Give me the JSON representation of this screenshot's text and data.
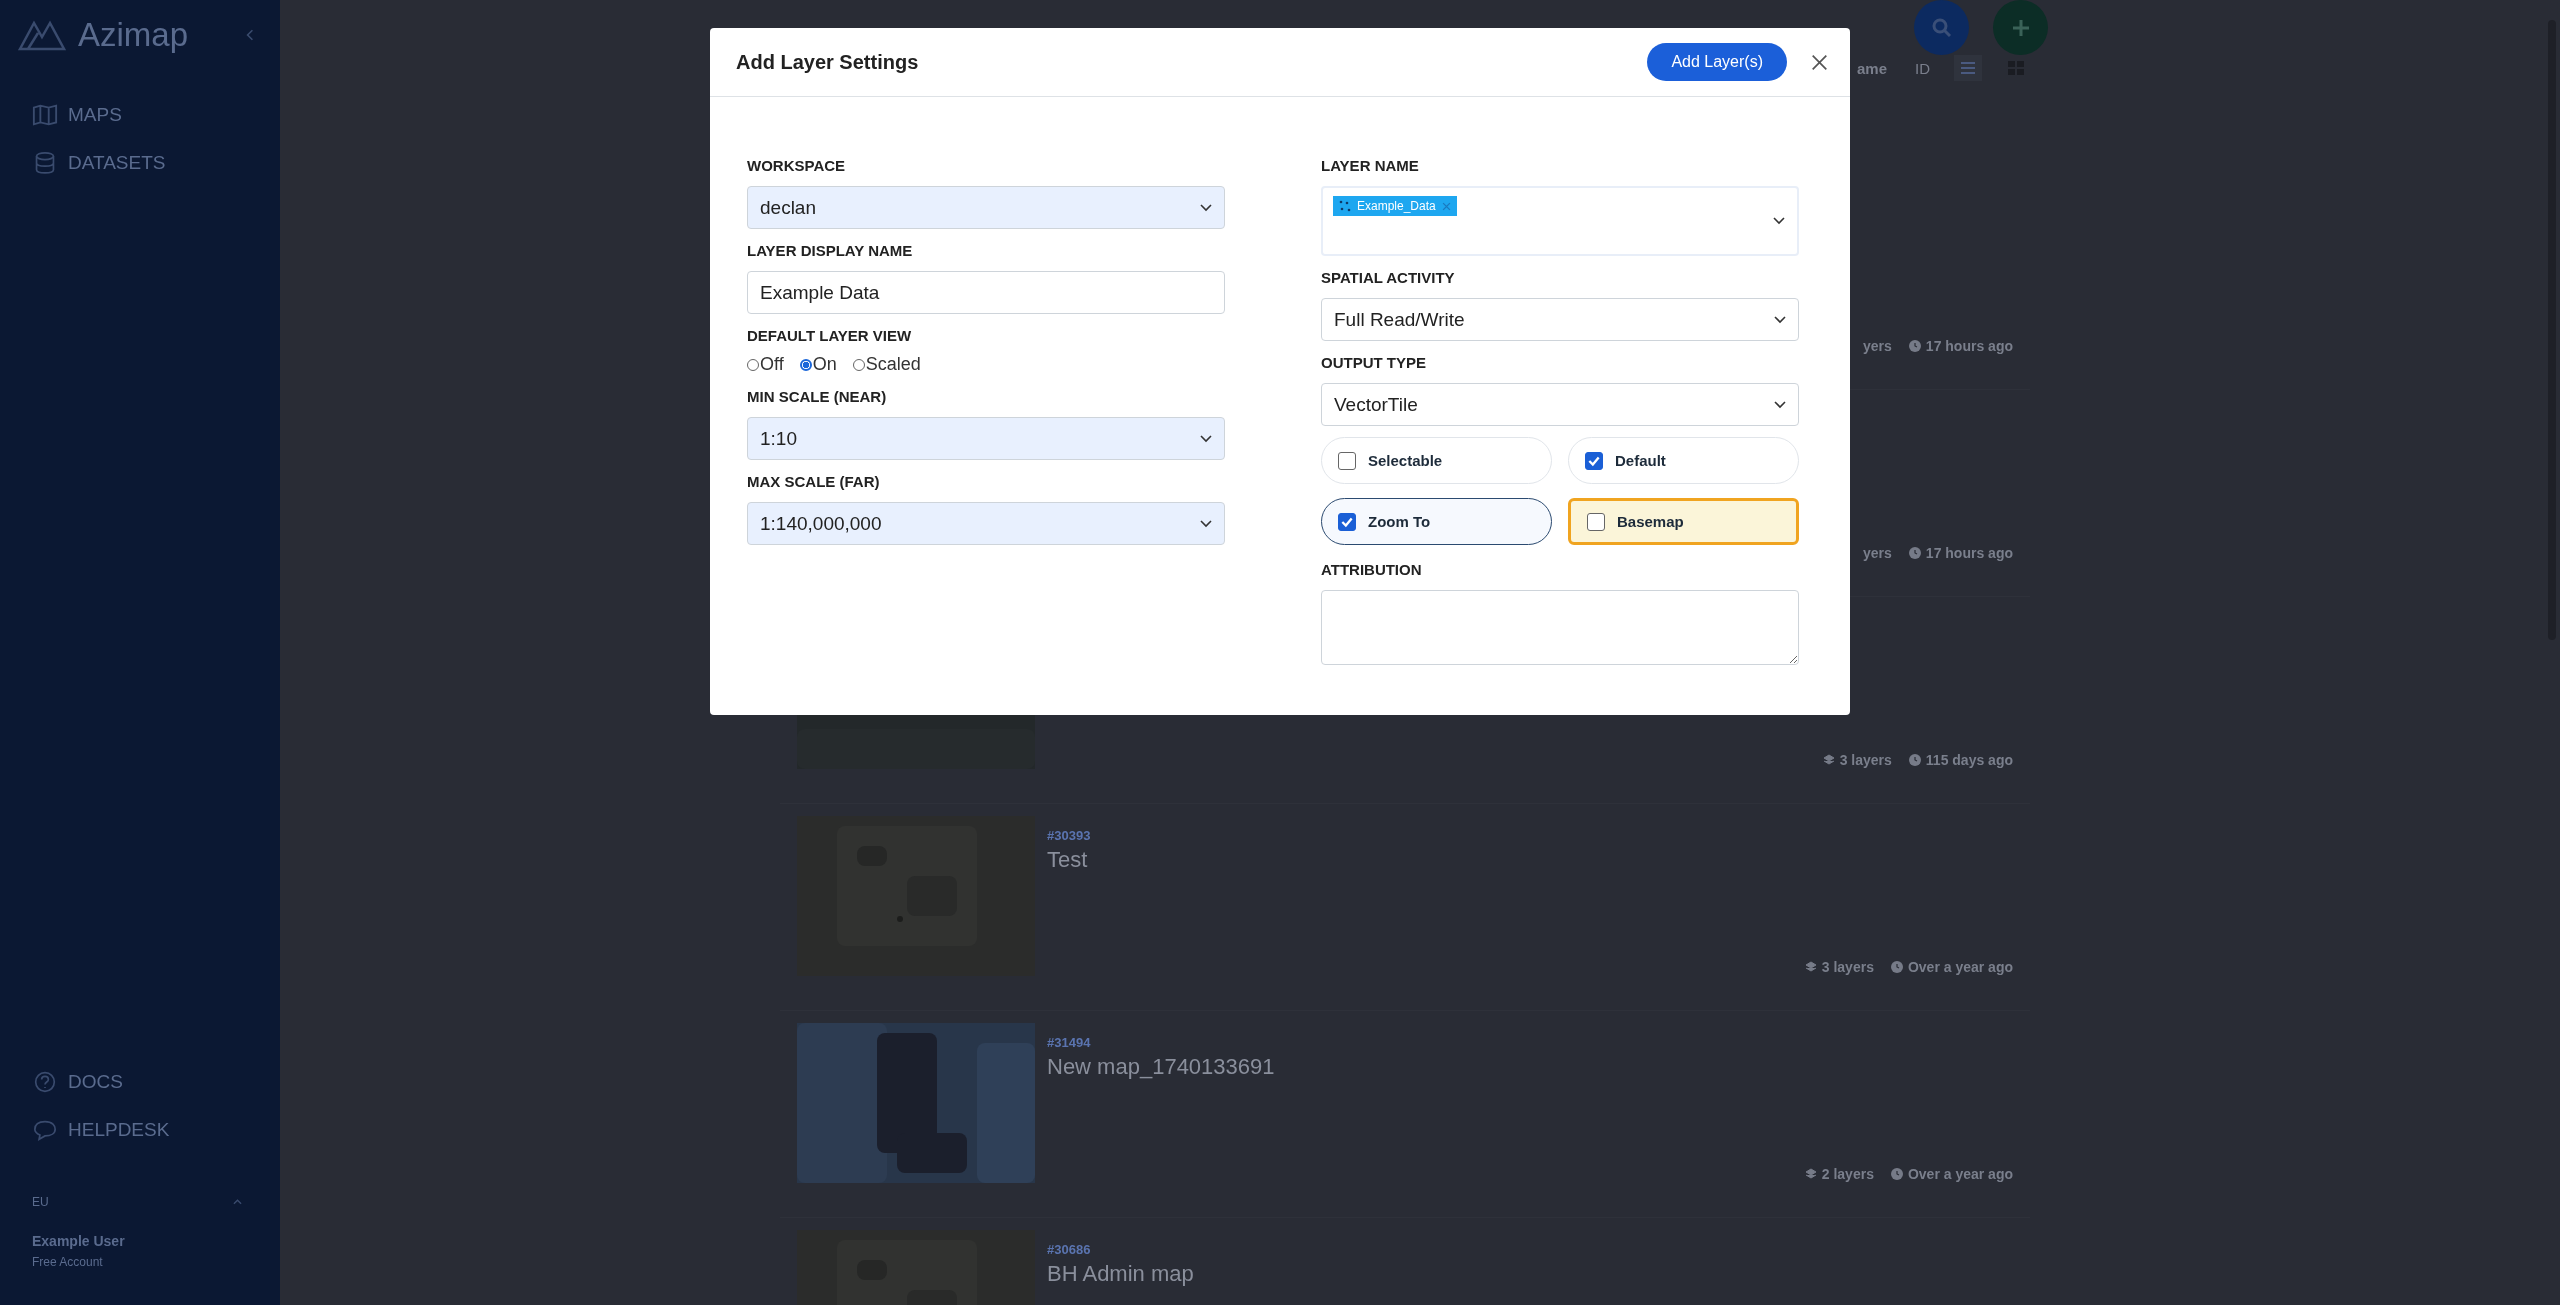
{
  "sidebar": {
    "logo": "Azimap",
    "nav": [
      {
        "label": "MAPS"
      },
      {
        "label": "DATASETS"
      }
    ],
    "help": [
      {
        "label": "DOCS"
      },
      {
        "label": "HELPDESK"
      }
    ],
    "user": {
      "initials": "EU",
      "name": "Example User",
      "plan": "Free Account"
    }
  },
  "toolbar": {
    "sort_options": [
      {
        "label": "ame",
        "selected": true
      },
      {
        "label": "ID",
        "selected": false
      }
    ],
    "views": [
      {
        "selected": true
      },
      {
        "selected": false
      }
    ]
  },
  "maps": [
    {
      "kind": "covered",
      "layers": "yers",
      "updated": "17 hours ago"
    },
    {
      "kind": "covered",
      "layers": "yers",
      "updated": "17 hours ago"
    },
    {
      "kind": "partial",
      "layers": "3 layers",
      "updated": "115 days ago"
    },
    {
      "kind": "full",
      "id": "#30393",
      "title": "Test",
      "layers": "3 layers",
      "updated": "Over a year ago"
    },
    {
      "kind": "full",
      "id": "#31494",
      "title": "New map_1740133691",
      "layers": "2 layers",
      "updated": "Over a year ago"
    },
    {
      "kind": "cut",
      "id": "#30686",
      "title": "BH Admin map"
    }
  ],
  "dialog": {
    "title": "Add Layer Settings",
    "primary_button": "Add Layer(s)",
    "left": [
      {
        "kind": "select",
        "label": "WORKSPACE",
        "value": "declan",
        "autofilled": true
      },
      {
        "kind": "text",
        "label": "LAYER DISPLAY NAME",
        "value": "Example Data"
      },
      {
        "kind": "radios",
        "label": "DEFAULT LAYER VIEW",
        "options": [
          {
            "label": "Off",
            "selected": false
          },
          {
            "label": "On",
            "selected": true
          },
          {
            "label": "Scaled",
            "selected": false
          }
        ]
      },
      {
        "kind": "select",
        "label": "MIN SCALE (NEAR)",
        "value": "1:10",
        "autofilled": true
      },
      {
        "kind": "select",
        "label": "MAX SCALE (FAR)",
        "value": "1:140,000,000",
        "autofilled": true
      }
    ],
    "right": [
      {
        "kind": "tags",
        "label": "LAYER NAME",
        "tags": [
          "Example_Data"
        ]
      },
      {
        "kind": "select",
        "label": "SPATIAL ACTIVITY",
        "value": "Full Read/Write",
        "autofilled": false
      },
      {
        "kind": "select",
        "label": "OUTPUT TYPE",
        "value": "VectorTile",
        "autofilled": false
      },
      {
        "kind": "checks",
        "options": [
          {
            "label": "Selectable",
            "checked": false,
            "kind": "plain"
          },
          {
            "label": "Default",
            "checked": true,
            "kind": "plain"
          },
          {
            "label": "Zoom To",
            "checked": true,
            "kind": "focused"
          },
          {
            "label": "Basemap",
            "checked": false,
            "kind": "warning"
          }
        ]
      },
      {
        "kind": "textarea",
        "label": "ATTRIBUTION"
      }
    ]
  }
}
